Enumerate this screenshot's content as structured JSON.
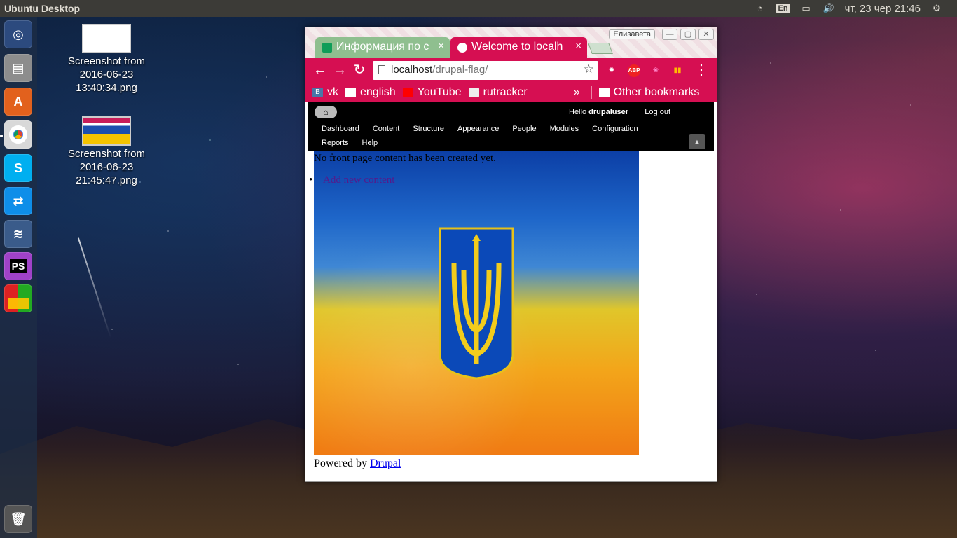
{
  "panel": {
    "title": "Ubuntu Desktop",
    "keyboard": "En",
    "clock": "чт, 23 чер 21:46"
  },
  "launcher": {
    "items": [
      "ubuntu-dash",
      "files",
      "software-center",
      "chrome",
      "skype",
      "teamviewer",
      "mysql-workbench",
      "phpstorm",
      "workspaces"
    ],
    "trash": "trash"
  },
  "desktop": {
    "icons": [
      {
        "label": "Screenshot from 2016-06-23 13:40:34.png"
      },
      {
        "label": "Screenshot from 2016-06-23 21:45:47.png"
      }
    ]
  },
  "browser": {
    "profile": "Елизавета",
    "tabs": [
      {
        "title": "Информация по с"
      },
      {
        "title": "Welcome to localh"
      }
    ],
    "url": {
      "host": "localhost",
      "path": "/drupal-flag/"
    },
    "extensions": [
      "ABP"
    ],
    "bookmarks": [
      "vk",
      "english",
      "YouTube",
      "rutracker"
    ],
    "bookmarks_overflow": "»",
    "other_bookmarks": "Other bookmarks"
  },
  "drupal": {
    "hello_prefix": "Hello",
    "user": "drupaluser",
    "logout": "Log out",
    "menu": [
      "Dashboard",
      "Content",
      "Structure",
      "Appearance",
      "People",
      "Modules",
      "Configuration",
      "Reports",
      "Help"
    ],
    "message": "No front page content has been created yet.",
    "add_link": "Add new content",
    "powered_prefix": "Powered by",
    "powered_link": "Drupal"
  },
  "colors": {
    "accent": "#d60f52",
    "panel": "#3c3b37"
  }
}
